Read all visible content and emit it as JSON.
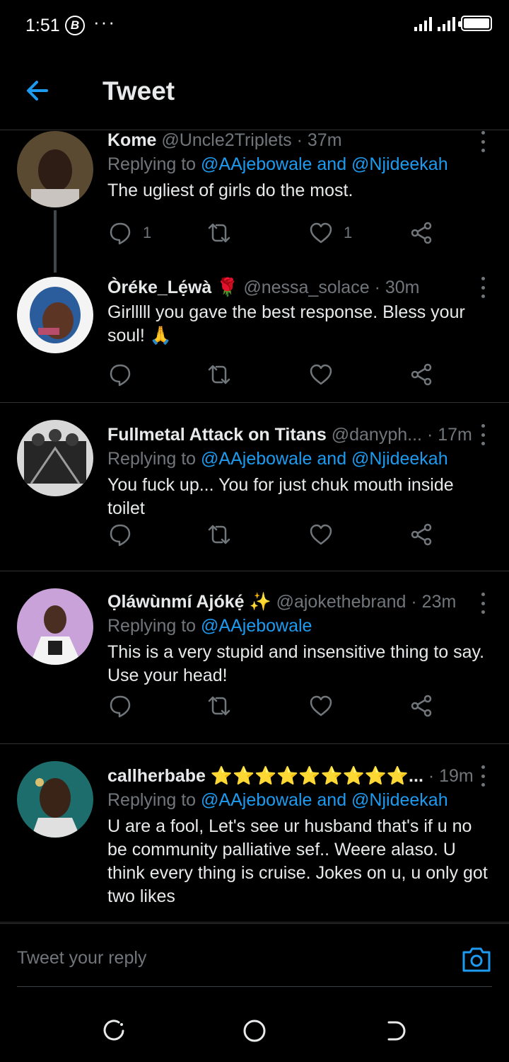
{
  "status_bar": {
    "time": "1:51",
    "b_icon": "B",
    "dots": "···"
  },
  "header": {
    "title": "Tweet"
  },
  "tweets": [
    {
      "name": "Kome",
      "handle": "@Uncle2Triplets",
      "time": "· 37m",
      "replying_prefix": "Replying to ",
      "replying_to": "@AAjebowale and @Njideekah",
      "text": "The ugliest of girls do the most.",
      "reply_count": "1",
      "retweet_count": "",
      "like_count": "1"
    },
    {
      "name": "Òréke_Lẹ́wà 🌹",
      "handle": "@nessa_solace",
      "time": "· 30m",
      "text": "Girlllll you gave the best response. Bless your soul! 🙏",
      "reply_count": "",
      "retweet_count": "",
      "like_count": ""
    },
    {
      "name": "Fullmetal Attack on Titans",
      "handle": "@danyph...",
      "time": "· 17m",
      "replying_prefix": "Replying to ",
      "replying_to": "@AAjebowale and @Njideekah",
      "text": "You fuck up... You for just chuk mouth inside toilet",
      "reply_count": "",
      "retweet_count": "",
      "like_count": ""
    },
    {
      "name": "Ọláwùnmí Ajókẹ́ ✨",
      "handle": "@ajokethebrand",
      "time": "· 23m",
      "replying_prefix": "Replying to ",
      "replying_to": "@AAjebowale",
      "text": "This is a very stupid and insensitive thing to say. Use your head!",
      "reply_count": "",
      "retweet_count": "",
      "like_count": ""
    },
    {
      "name": "callherbabe ⭐⭐⭐⭐⭐⭐⭐⭐⭐...",
      "handle": "",
      "time": "· 19m",
      "replying_prefix": "Replying to ",
      "replying_to": "@AAjebowale and @Njideekah",
      "text": "U are a fool, Let's see ur husband that's if u no be community palliative sef.. Weere alaso. U think every thing is cruise. Jokes on u, u only got two likes"
    }
  ],
  "reply_bar": {
    "placeholder": "Tweet your reply"
  },
  "colors": {
    "accent": "#1d9bf0",
    "muted": "#71767b",
    "text": "#e7e9ea",
    "divider": "#2f3336"
  }
}
